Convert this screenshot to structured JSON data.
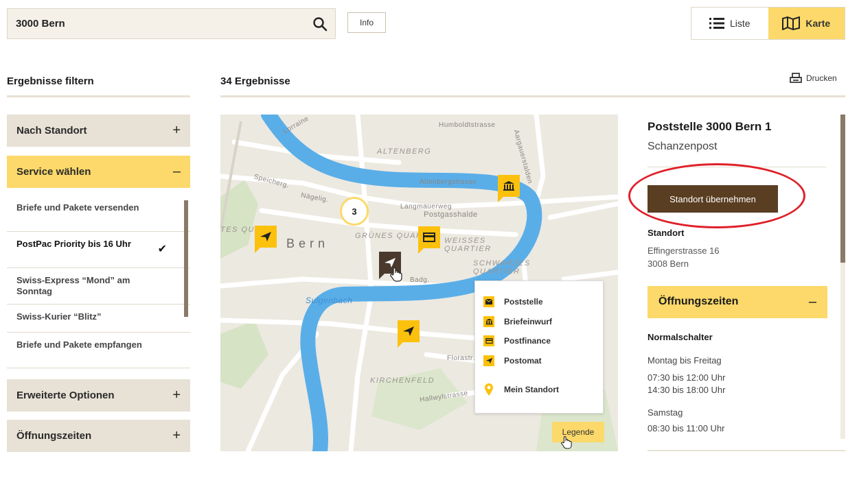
{
  "search": {
    "value": "3000 Bern",
    "placeholder": ""
  },
  "info_label": "Info",
  "view": {
    "list_label": "Liste",
    "map_label": "Karte",
    "active": "map"
  },
  "filter": {
    "title": "Ergebnisse filtern",
    "sections": [
      {
        "label": "Nach Standort",
        "sign": "+"
      },
      {
        "label": "Service wählen",
        "sign": "–"
      },
      {
        "label": "Erweiterte Optionen",
        "sign": "+"
      },
      {
        "label": "Öffnungszeiten",
        "sign": "+"
      }
    ],
    "services": [
      {
        "label": "Briefe und Pakete versenden",
        "selected": false
      },
      {
        "label": "PostPac Priority bis 16 Uhr",
        "selected": true
      },
      {
        "label": "Swiss-Express “Mond” am Sonntag",
        "selected": false
      },
      {
        "label": "Swiss-Kurier “Blitz”",
        "selected": false
      },
      {
        "label": "Briefe und Pakete empfangen",
        "selected": false
      }
    ],
    "check_mark": "✔"
  },
  "results": {
    "count_label": "34 Ergebnisse",
    "print_label": "Drucken"
  },
  "map": {
    "labels": {
      "humboldtstrasse": "Humboldtstrasse",
      "altenberg": "ALTENBERG",
      "aargauerstalden": "Aargauerstalden",
      "lorraine": "Lorraine",
      "speicherg": "Speicherg.",
      "naegelig": "Nägelig.",
      "bern": "Bern",
      "gruenes_quartier": "GRÜNES QUAR",
      "weisses_quartier": "WEISSES QUARTIER",
      "schwarzes_quartier": "SCHWARZES QUARTIER",
      "postgasshalde": "Postgasshalde",
      "langmauerweg": "Langmauerweg",
      "altenbergstrasse": "Altenbergstrasse",
      "sulgenbach": "Sulgenbach",
      "kirchenfeld": "KIRCHENFELD",
      "hallwylstrasse": "Hallwylstrasse",
      "florastr": "Florastr.",
      "tes_qua": "TES QUA",
      "badg": "Badg."
    },
    "cluster_count": "3",
    "legend": {
      "items": [
        {
          "label": "Poststelle",
          "icon": "envelope-icon"
        },
        {
          "label": "Briefeinwurf",
          "icon": "building-icon"
        },
        {
          "label": "Postfinance",
          "icon": "card-icon"
        },
        {
          "label": "Postomat",
          "icon": "paper-plane-icon"
        },
        {
          "label": "Mein Standort",
          "icon": "location-pin-icon"
        }
      ],
      "button_label": "Legende"
    }
  },
  "detail": {
    "title": "Poststelle 3000 Bern 1",
    "subtitle": "Schanzenpost",
    "take_button": "Standort übernehmen",
    "location_label": "Standort",
    "street": "Effingerstrasse 16",
    "city": "3008 Bern",
    "hours_label": "Öffnungszeiten",
    "hours_sign": "–",
    "counter_label": "Normalschalter",
    "weekdays_label": "Montag bis Freitag",
    "weekdays_morning": "07:30 bis 12:00 Uhr",
    "weekdays_afternoon": "14:30 bis 18:00 Uhr",
    "saturday_label": "Samstag",
    "saturday_hours": "08:30 bis 11:00 Uhr"
  },
  "colors": {
    "accent_yellow": "#fcd96a",
    "marker_yellow": "#fcc10c",
    "brown": "#5a3e22",
    "annotation_red": "#e0202a",
    "river_blue": "#5aaee8"
  }
}
